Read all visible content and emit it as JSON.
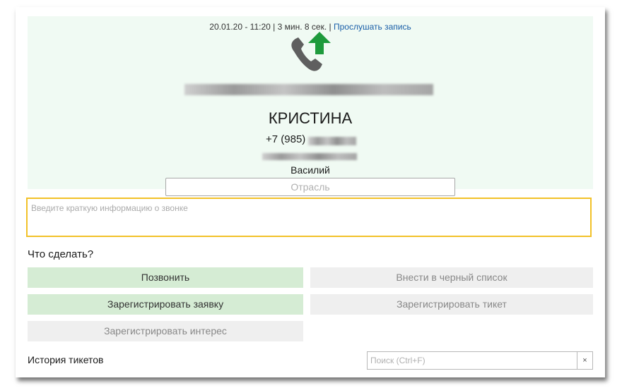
{
  "call": {
    "datetime": "20.01.20 - 11:20",
    "separator": "|",
    "duration": "3 мин. 8 сек.",
    "listen_link": "Прослушать запись",
    "direction": "outgoing",
    "phone_icon": "phone-icon",
    "arrow_icon": "arrow-up-icon"
  },
  "client": {
    "name": "КРИСТИНА",
    "phone_prefix": "+7 (985)",
    "manager": "Василий",
    "industry_placeholder": "Отрасль"
  },
  "note": {
    "placeholder": "Введите краткую информацию о звонке"
  },
  "actions": {
    "title": "Что сделать?",
    "call": "Позвонить",
    "blacklist": "Внести в черный список",
    "register_request": "Зарегистрировать заявку",
    "register_ticket": "Зарегистрировать тикет",
    "register_interest": "Зарегистрировать интерес"
  },
  "history": {
    "title": "История тикетов",
    "search_placeholder": "Поиск (Ctrl+F)",
    "clear": "×"
  },
  "colors": {
    "header_bg": "#f0faf3",
    "accent_green": "#1e9a3c",
    "link": "#1a5fa8",
    "note_border": "#f2c128",
    "button_green": "#d5ecd4",
    "button_gray": "#efefef"
  }
}
